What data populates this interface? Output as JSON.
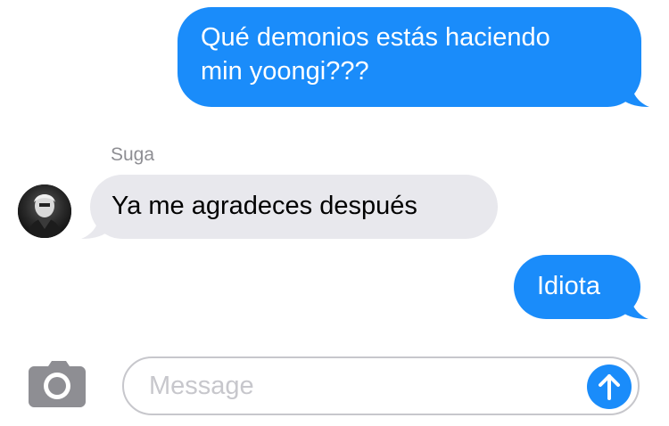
{
  "conversation": {
    "messages": [
      {
        "direction": "outgoing",
        "text": "Qué demonios estás haciendo\nmin yoongi???"
      },
      {
        "direction": "incoming",
        "sender": "Suga",
        "text": "Ya me agradeces después"
      },
      {
        "direction": "outgoing",
        "text": "Idiota"
      }
    ]
  },
  "composer": {
    "placeholder": "Message",
    "value": "",
    "camera_icon": "camera-icon",
    "send_icon": "arrow-up-icon"
  },
  "colors": {
    "outgoing_bubble": "#1a8cfa",
    "incoming_bubble": "#e8e8ed",
    "sender_name": "#8e8e93",
    "placeholder": "#c7c7cc",
    "camera_icon": "#8e8e93"
  }
}
